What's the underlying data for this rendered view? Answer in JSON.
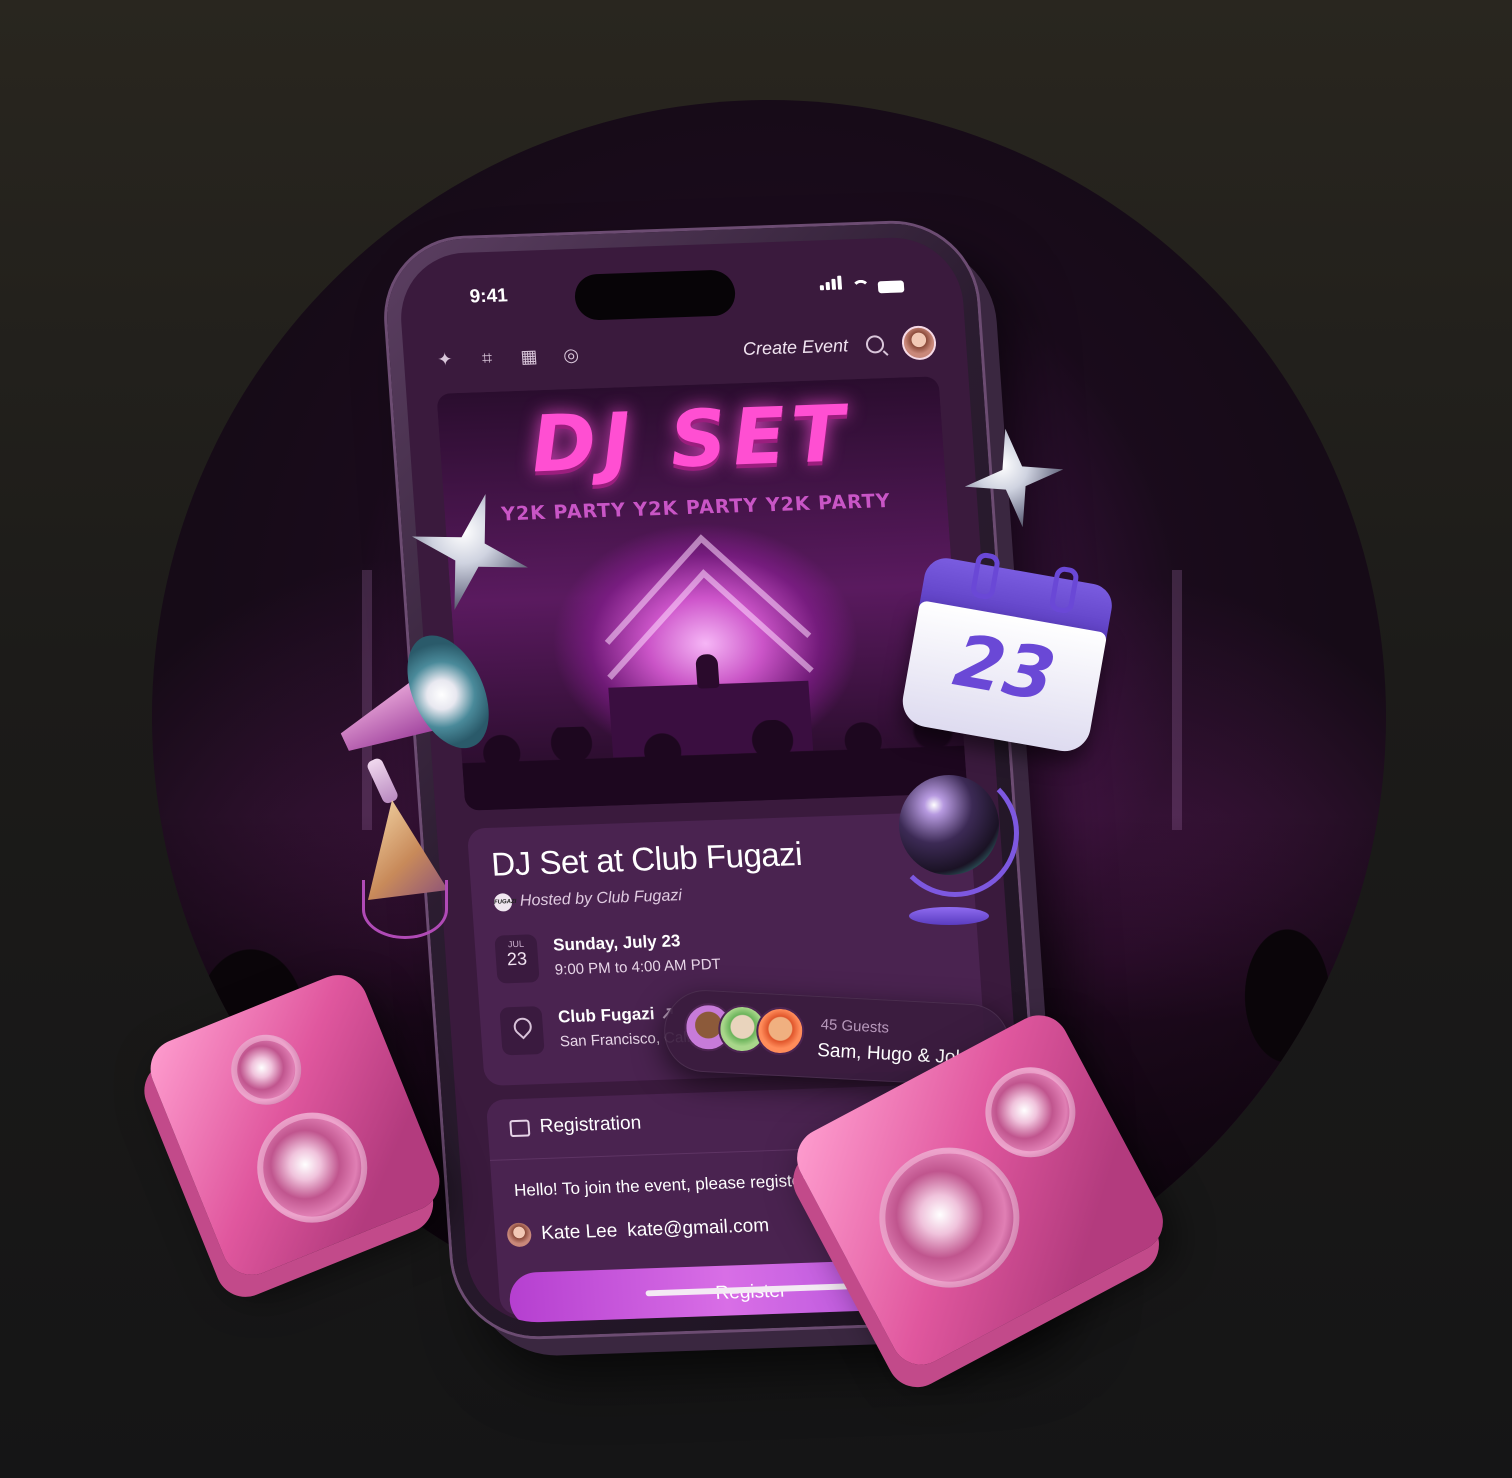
{
  "status_bar": {
    "time": "9:41"
  },
  "nav": {
    "icons": [
      "sparkle-icon",
      "ticket-icon",
      "calendar-icon",
      "compass-icon"
    ],
    "create_event": "Create Event",
    "search_icon": "search-icon"
  },
  "poster": {
    "title": "DJ SET",
    "subtitle": "Y2K PARTY Y2K PARTY Y2K PARTY"
  },
  "event": {
    "title": "DJ Set at Club Fugazi",
    "hosted_by": "Hosted by Club Fugazi",
    "host_logo_text": "FUGAZI",
    "date": {
      "month": "JUL",
      "day": "23",
      "full_date": "Sunday, July 23",
      "time_range": "9:00 PM to 4:00 AM PDT"
    },
    "location": {
      "name": "Club Fugazi",
      "arrow": "↗",
      "city": "San Francisco, California"
    }
  },
  "guests": {
    "count_label": "45 Guests",
    "names": "Sam, Hugo & John"
  },
  "registration": {
    "heading": "Registration",
    "message": "Hello! To join the event, please register below.",
    "user_name": "Kate Lee",
    "user_email": "kate@gmail.com",
    "button_label": "Register"
  },
  "decor": {
    "calendar_number": "23"
  },
  "colors": {
    "accent": "#c24fd6",
    "card": "#4a2350",
    "screen": "#3a1a3d",
    "poster_pink": "#ff4fd2"
  }
}
